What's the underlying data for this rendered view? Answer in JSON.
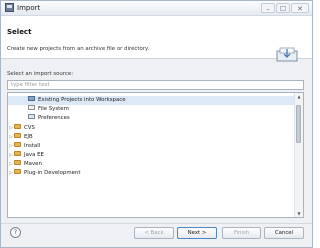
{
  "window": {
    "title": "Import",
    "minimize_glyph": "–",
    "maximize_glyph": "☐",
    "close_glyph": "✕"
  },
  "header": {
    "title": "Select",
    "description": "Create new projects from an archive file or directory."
  },
  "source": {
    "label": "Select an import source:",
    "filter_placeholder": "type filter text"
  },
  "tree": {
    "items": [
      {
        "label": "Existing Projects into Workspace",
        "icon": "project-icon",
        "expanded": null,
        "selected": true
      },
      {
        "label": "File System",
        "icon": "file-icon",
        "expanded": null,
        "selected": false
      },
      {
        "label": "Preferences",
        "icon": "preferences-icon",
        "expanded": null,
        "selected": false
      },
      {
        "label": "CVS",
        "icon": "folder-icon",
        "expanded": false,
        "selected": false
      },
      {
        "label": "EJB",
        "icon": "folder-icon",
        "expanded": false,
        "selected": false
      },
      {
        "label": "Install",
        "icon": "folder-icon",
        "expanded": false,
        "selected": false
      },
      {
        "label": "Java EE",
        "icon": "folder-icon",
        "expanded": false,
        "selected": false
      },
      {
        "label": "Maven",
        "icon": "folder-icon",
        "expanded": false,
        "selected": false
      },
      {
        "label": "Plug-in Development",
        "icon": "folder-icon",
        "expanded": false,
        "selected": false
      }
    ]
  },
  "buttons": {
    "help": "?",
    "back": "< Back",
    "next": "Next >",
    "finish": "Finish",
    "cancel": "Cancel"
  },
  "colors": {
    "selection": "#dde8f6",
    "folder": "#e2b452",
    "accent": "#4f86c7"
  }
}
